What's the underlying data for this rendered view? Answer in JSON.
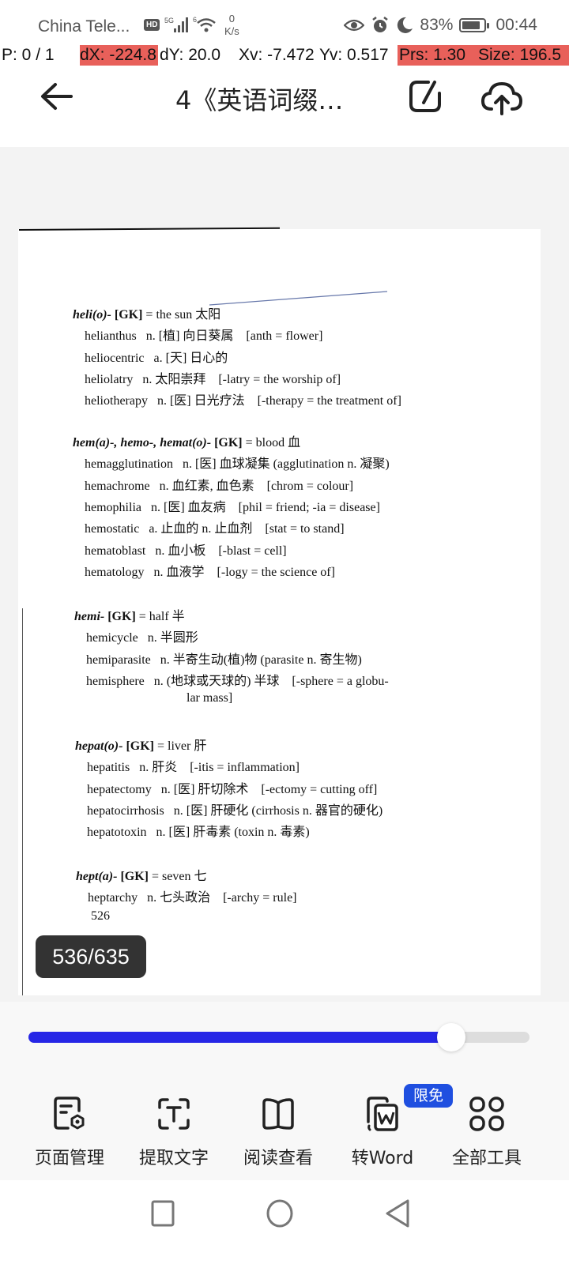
{
  "status_bar": {
    "carrier": "China Tele...",
    "hd": "HD",
    "network": "5G",
    "wifi": "6",
    "net_speed_value": "0",
    "net_speed_unit": "K/s",
    "battery": "83%",
    "battery_level": 0.83,
    "time": "00:44"
  },
  "debug_overlay": {
    "pointer": "P: 0 / 1",
    "dx": "dX: -224.8",
    "dy": "dY: 20.0",
    "xv": "Xv: -7.472",
    "yv": "Yv: 0.517",
    "prs": "Prs: 1.30",
    "size": "Size: 196.5"
  },
  "app_bar": {
    "back_icon": "arrow-left-icon",
    "title": "4《英语词缀…",
    "edit_icon": "edit-export-icon",
    "upload_icon": "cloud-upload-icon"
  },
  "document": {
    "groups": [
      {
        "root": "heli(o)-",
        "origin": "[GK]",
        "meaning": "= the sun 太阳",
        "entries": [
          "helianthus   n. [植] 向日葵属    [anth = flower]",
          "heliocentric   a. [天] 日心的",
          "heliolatry   n. 太阳崇拜    [-latry = the worship of]",
          "heliotherapy   n. [医] 日光疗法    [-therapy = the treatment of]"
        ]
      },
      {
        "root": "hem(a)-, hemo-, hemat(o)-",
        "origin": "[GK]",
        "meaning": "= blood 血",
        "entries": [
          "hemagglutination   n. [医] 血球凝集 (agglutination n. 凝聚)",
          "hemachrome   n. 血红素, 血色素    [chrom = colour]",
          "hemophilia   n. [医] 血友病    [phil = friend; -ia = disease]",
          "hemostatic   a. 止血的 n. 止血剂    [stat = to stand]",
          "hematoblast   n. 血小板    [-blast = cell]",
          "hematology   n. 血液学    [-logy = the science of]"
        ]
      },
      {
        "root": "hemi-",
        "origin": "[GK]",
        "meaning": "= half 半",
        "entries": [
          "hemicycle   n. 半圆形",
          "hemiparasite   n. 半寄生动(植)物 (parasite n. 寄生物)",
          "hemisphere   n. (地球或天球的) 半球    [-sphere = a globu-",
          "lar mass]"
        ]
      },
      {
        "root": "hepat(o)-",
        "origin": "[GK]",
        "meaning": "= liver 肝",
        "entries": [
          "hepatitis   n. 肝炎    [-itis = inflammation]",
          "hepatectomy   n. [医] 肝切除术    [-ectomy = cutting off]",
          "hepatocirrhosis   n. [医] 肝硬化 (cirrhosis n. 器官的硬化)",
          "hepatotoxin   n. [医] 肝毒素 (toxin n. 毒素)"
        ]
      },
      {
        "root": "hept(a)-",
        "origin": "[GK]",
        "meaning": "= seven 七",
        "entries": [
          "heptarchy   n. 七头政治    [-archy = rule]"
        ]
      }
    ],
    "printed_page_number": "526"
  },
  "page_counter": "536/635",
  "progress": {
    "current_page": 536,
    "total_pages": 635,
    "fraction": 0.844
  },
  "toolbar": {
    "items": [
      {
        "label": "页面管理",
        "icon": "page-manage-icon"
      },
      {
        "label": "提取文字",
        "icon": "text-extract-icon"
      },
      {
        "label": "阅读查看",
        "icon": "book-read-icon"
      },
      {
        "label": "转Word",
        "icon": "word-convert-icon"
      },
      {
        "label": "全部工具",
        "icon": "all-tools-grid-icon"
      }
    ],
    "badge": "限免",
    "badge_color": "#1f4fe0"
  },
  "colors": {
    "slider_fill": "#2626e6",
    "debug_highlight": "#e8605a"
  }
}
